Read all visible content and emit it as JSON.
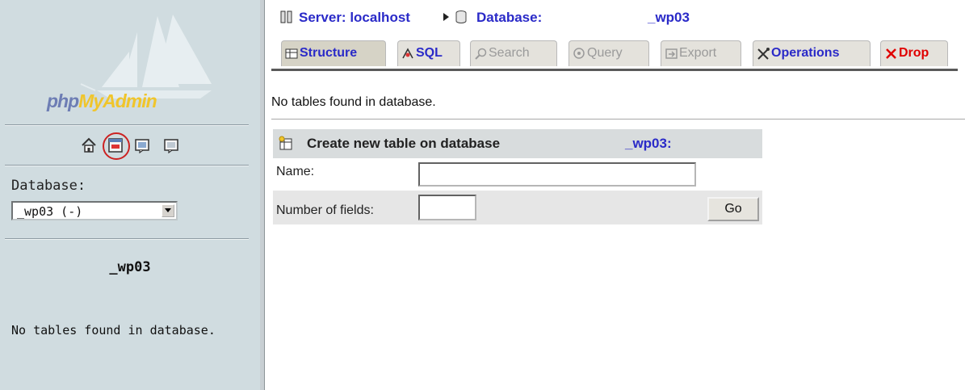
{
  "nav": {
    "logo": {
      "part1": "php",
      "part2": "MyAdmin"
    },
    "icons": [
      "home-icon",
      "sql-query-icon",
      "docs-icon",
      "changelog-icon"
    ],
    "database_label": "Database:",
    "database_select": {
      "selected": "_wp03 (-)"
    },
    "db_name": "_wp03",
    "empty_message": "No tables found in database."
  },
  "breadcrumb": {
    "server": "Server: localhost",
    "database_label": "Database:",
    "database_name": "_wp03"
  },
  "tabs": [
    {
      "label": "Structure",
      "icon": "structure-icon",
      "state": "active"
    },
    {
      "label": "SQL",
      "icon": "sql-icon",
      "state": "link"
    },
    {
      "label": "Search",
      "icon": "search-icon",
      "state": "disabled"
    },
    {
      "label": "Query",
      "icon": "query-icon",
      "state": "disabled"
    },
    {
      "label": "Export",
      "icon": "export-icon",
      "state": "disabled"
    },
    {
      "label": "Operations",
      "icon": "operations-icon",
      "state": "link"
    },
    {
      "label": "Drop",
      "icon": "drop-icon",
      "state": "danger"
    }
  ],
  "main": {
    "no_tables": "No tables found in database.",
    "create": {
      "title": "Create new table on database",
      "database": "_wp03:",
      "name_label": "Name:",
      "name_value": "",
      "fields_label": "Number of fields:",
      "fields_value": "",
      "go_label": "Go"
    }
  },
  "colors": {
    "nav_bg": "#d0dce0",
    "link": "#2a2ac8",
    "drop": "#e00000",
    "highlight_circle": "#cc2222",
    "logo_blue": "#6d7db4",
    "logo_yellow": "#f0c52b"
  }
}
